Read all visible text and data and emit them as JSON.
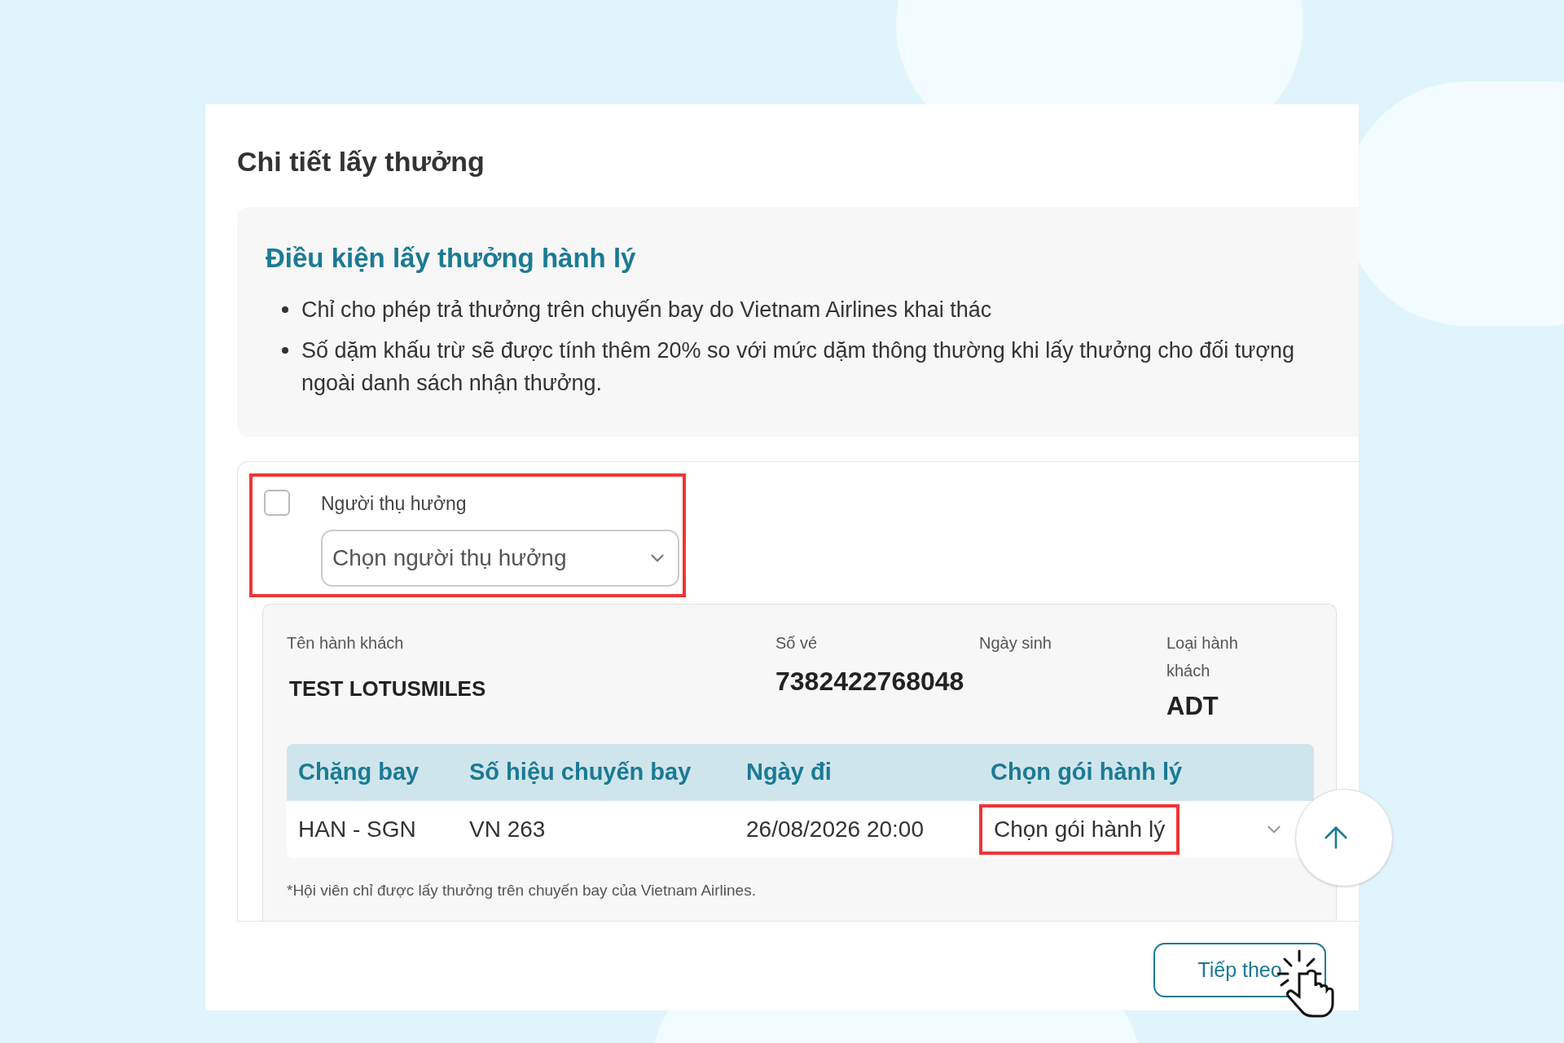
{
  "title": "Chi tiết lấy thưởng",
  "conditions": {
    "heading": "Điều kiện lấy thưởng hành lý",
    "items": [
      "Chỉ cho phép trả thưởng trên chuyến bay do Vietnam Airlines khai thác",
      "Số dặm khấu trừ sẽ được tính thêm 20% so với mức dặm thông thường khi lấy thưởng cho đối tượng ngoài danh sách nhận thưởng."
    ]
  },
  "beneficiary": {
    "checked": false,
    "label": "Người thụ hưởng",
    "select_placeholder": "Chọn người thụ hưởng"
  },
  "passenger": {
    "fields": [
      {
        "label": "Tên hành khách",
        "value": "TEST LOTUSMILES"
      },
      {
        "label": "Số vé",
        "value": "7382422768048"
      },
      {
        "label": "Ngày sinh"
      },
      {
        "label": "Loại hành khách",
        "value": "ADT"
      }
    ]
  },
  "table": {
    "columns": [
      "Chặng bay",
      "Số hiệu chuyến bay",
      "Ngày đi",
      "Chọn gói hành lý"
    ],
    "rows": [
      {
        "cells": [
          "HAN - SGN",
          "VN 263",
          "26/08/2026 20:00"
        ],
        "baggage_select": "Chọn gói hành lý"
      }
    ]
  },
  "footnote": "*Hội viên chỉ được lấy thưởng trên chuyến bay của Vietnam Airlines.",
  "next_button": "Tiếp theo"
}
